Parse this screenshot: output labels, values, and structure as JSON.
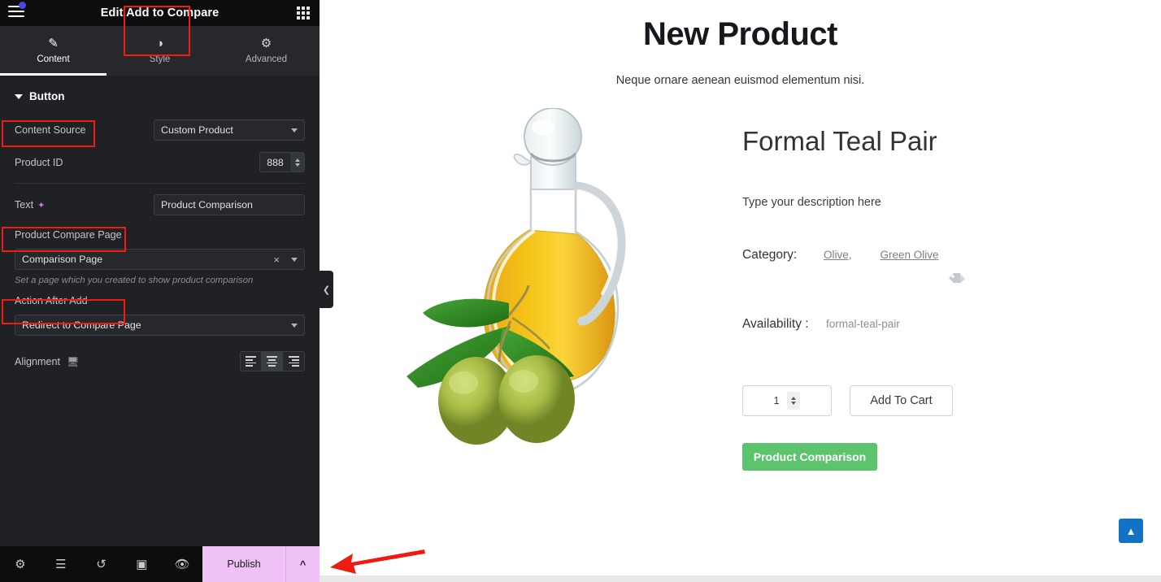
{
  "panel": {
    "title": "Edit Add to Compare",
    "menu_icon": "hamburger-icon",
    "apps_icon": "apps-grid-icon",
    "tabs": [
      {
        "label": "Content",
        "icon": "pencil-icon",
        "active": true
      },
      {
        "label": "Style",
        "icon": "contrast-icon",
        "active": false
      },
      {
        "label": "Advanced",
        "icon": "gear-icon",
        "active": false
      }
    ],
    "section": {
      "title": "Button"
    },
    "controls": {
      "content_source_label": "Content Source",
      "content_source_value": "Custom Product",
      "product_id_label": "Product ID",
      "product_id_value": "888",
      "text_label": "Text",
      "text_value": "Product Comparison",
      "compare_page_label": "Product Compare Page",
      "compare_page_value": "Comparison Page",
      "compare_page_help": "Set a page which you created to show product comparison",
      "action_after_add_label": "Action After Add",
      "action_after_add_value": "Redirect to Compare Page",
      "alignment_label": "Alignment",
      "alignment_options": [
        "left",
        "center",
        "right"
      ],
      "alignment_selected": "center"
    },
    "footer": {
      "icons": [
        "gear-icon",
        "layers-icon",
        "history-icon",
        "responsive-icon",
        "preview-icon"
      ],
      "publish_label": "Publish",
      "publish_caret": "chevron-up-icon"
    },
    "collapse_handle": "chevron-left-icon"
  },
  "canvas": {
    "page_title": "New Product",
    "page_subtitle": "Neque ornare aenean euismod elementum nisi.",
    "product": {
      "image_alt": "olive-oil-bottle-with-olives",
      "name": "Formal Teal Pair",
      "description": "Type your description here",
      "category_label": "Category:",
      "categories": [
        "Olive,",
        "Green Olive"
      ],
      "availability_label": "Availability :",
      "availability_value": "formal-teal-pair",
      "quantity": "1",
      "add_to_cart_label": "Add To Cart",
      "compare_button_label": "Product Comparison"
    },
    "scroll_top_icon": "chevron-up-icon"
  },
  "annotations": {
    "highlight_color": "#f01c11",
    "arrow": "red-left-arrow"
  },
  "colors": {
    "panel_bg": "#1f2124",
    "panel_header_bg": "#0d0d0e",
    "accent_publish": "#f0c2f7",
    "compare_green": "#5cc46c",
    "scroll_top_blue": "#1273c4",
    "notif_dot": "#4a45e8"
  }
}
